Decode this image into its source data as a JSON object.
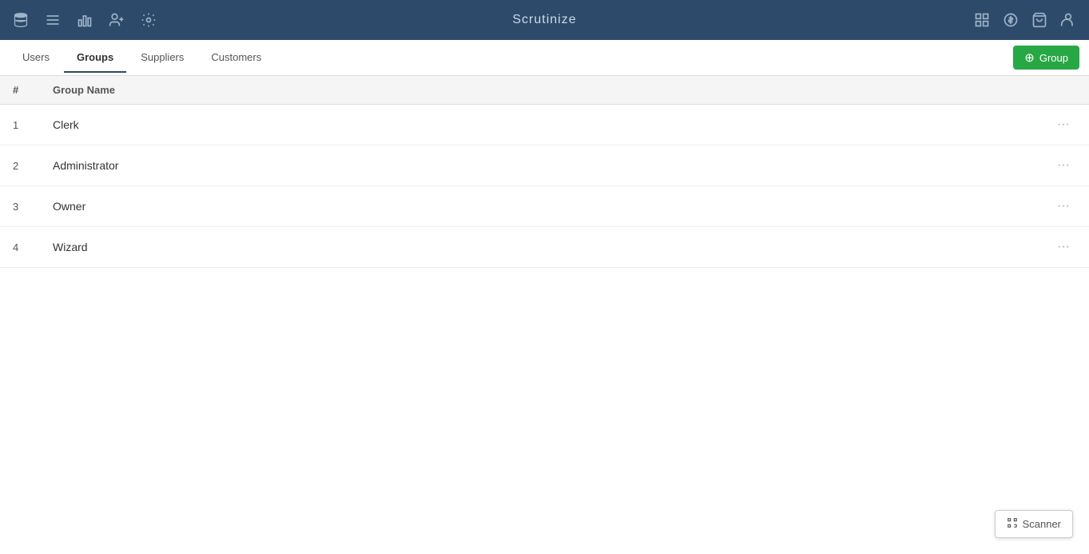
{
  "app": {
    "title": "Scrutinize"
  },
  "topnav": {
    "icons": [
      {
        "name": "database-icon",
        "symbol": "🗄"
      },
      {
        "name": "list-icon",
        "symbol": "☰"
      },
      {
        "name": "chart-icon",
        "symbol": "📊"
      },
      {
        "name": "users-icon",
        "symbol": "👥"
      },
      {
        "name": "settings-icon",
        "symbol": "⚙"
      }
    ],
    "right_icons": [
      {
        "name": "grid-icon",
        "symbol": "⊞"
      },
      {
        "name": "dollar-icon",
        "symbol": "$"
      },
      {
        "name": "cart-icon",
        "symbol": "🛒"
      },
      {
        "name": "profile-icon",
        "symbol": "👤"
      }
    ]
  },
  "tabs": [
    {
      "label": "Users",
      "id": "users",
      "active": false
    },
    {
      "label": "Groups",
      "id": "groups",
      "active": true
    },
    {
      "label": "Suppliers",
      "id": "suppliers",
      "active": false
    },
    {
      "label": "Customers",
      "id": "customers",
      "active": false
    }
  ],
  "add_button": {
    "label": "Group",
    "icon": "circle-plus"
  },
  "table": {
    "columns": [
      {
        "key": "num",
        "label": "#"
      },
      {
        "key": "group_name",
        "label": "Group Name"
      }
    ],
    "rows": [
      {
        "num": "1",
        "group_name": "Clerk"
      },
      {
        "num": "2",
        "group_name": "Administrator"
      },
      {
        "num": "3",
        "group_name": "Owner"
      },
      {
        "num": "4",
        "group_name": "Wizard"
      }
    ]
  },
  "scanner": {
    "label": "Scanner"
  }
}
